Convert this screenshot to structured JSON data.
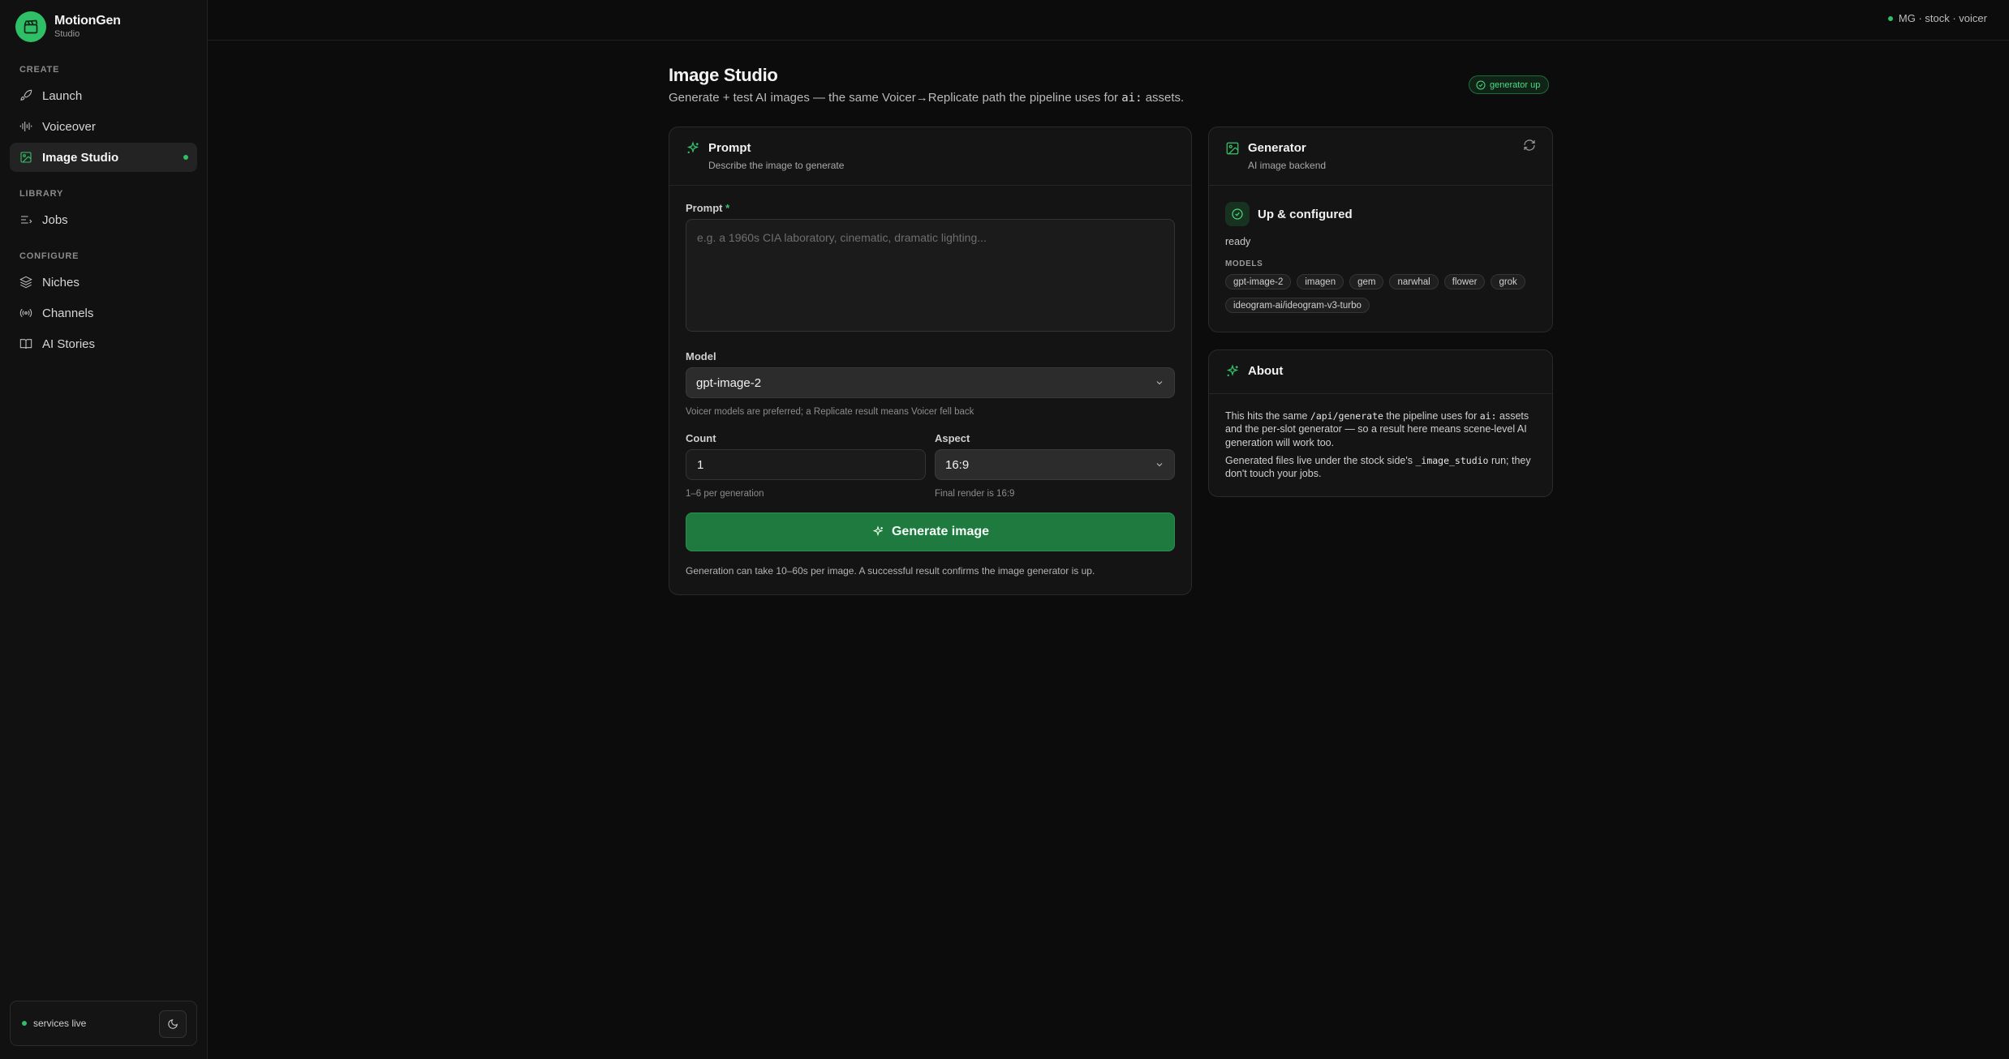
{
  "brand": {
    "name": "MotionGen",
    "sub": "Studio"
  },
  "sidebar": {
    "sections": [
      {
        "label": "CREATE"
      },
      {
        "label": "LIBRARY"
      },
      {
        "label": "CONFIGURE"
      }
    ],
    "items": [
      {
        "label": "Launch",
        "icon": "rocket-icon"
      },
      {
        "label": "Voiceover",
        "icon": "waveform-icon"
      },
      {
        "label": "Image Studio",
        "icon": "image-icon",
        "active": true
      },
      {
        "label": "Jobs",
        "icon": "list-icon"
      },
      {
        "label": "Niches",
        "icon": "layers-icon"
      },
      {
        "label": "Channels",
        "icon": "broadcast-icon"
      },
      {
        "label": "AI Stories",
        "icon": "book-icon"
      }
    ],
    "services_label": "services live"
  },
  "topbar": {
    "env_label": "MG · stock · voicer"
  },
  "header": {
    "title": "Image Studio",
    "subtitle_pre": "Generate + test AI images — the same Voicer→Replicate path the pipeline uses for ",
    "subtitle_code": "ai:",
    "subtitle_post": " assets.",
    "badge": "generator up"
  },
  "prompt_card": {
    "title": "Prompt",
    "subtitle": "Describe the image to generate",
    "prompt_label": "Prompt",
    "prompt_required": "*",
    "prompt_placeholder": "e.g. a 1960s CIA laboratory, cinematic, dramatic lighting...",
    "prompt_value": "",
    "model_label": "Model",
    "model_value": "gpt-image-2",
    "model_hint": "Voicer models are preferred; a Replicate result means Voicer fell back",
    "count_label": "Count",
    "count_value": "1",
    "count_hint": "1–6 per generation",
    "aspect_label": "Aspect",
    "aspect_value": "16:9",
    "aspect_hint": "Final render is 16:9",
    "generate_label": "Generate image",
    "footnote": "Generation can take 10–60s per image. A successful result confirms the image generator is up."
  },
  "generator_card": {
    "title": "Generator",
    "subtitle": "AI image backend",
    "status": "Up & configured",
    "state": "ready",
    "models_label": "MODELS",
    "models": [
      "gpt-image-2",
      "imagen",
      "gem",
      "narwhal",
      "flower",
      "grok",
      "ideogram-ai/ideogram-v3-turbo"
    ]
  },
  "about_card": {
    "title": "About",
    "p1_a": "This hits the same ",
    "p1_code1": "/api/generate",
    "p1_b": " the pipeline uses for ",
    "p1_code2": "ai:",
    "p1_c": " assets and the per-slot generator — so a result here means scene-level AI generation will work too.",
    "p2_a": "Generated files live under the stock side's ",
    "p2_code": "_image_studio",
    "p2_b": " run; they don't touch your jobs."
  },
  "colors": {
    "accent": "#2fbf66",
    "button": "#1f7a3f",
    "background": "#0c0c0c"
  }
}
